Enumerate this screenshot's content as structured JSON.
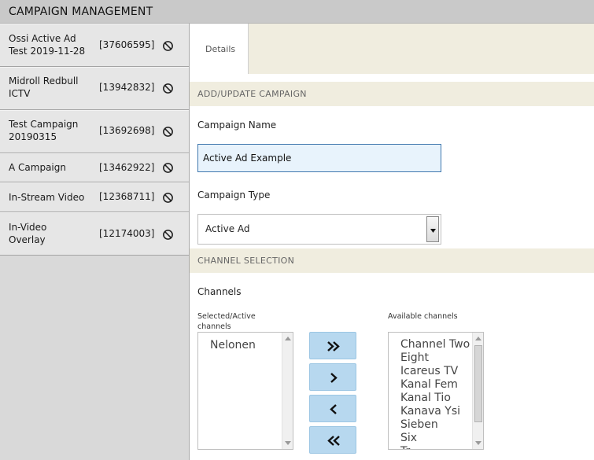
{
  "header": {
    "title": "CAMPAIGN MANAGEMENT"
  },
  "campaigns": [
    {
      "name": "Ossi Active Ad Test 2019-11-28",
      "id": "[37606595]"
    },
    {
      "name": "Midroll Redbull ICTV",
      "id": "[13942832]"
    },
    {
      "name": "Test Campaign 20190315",
      "id": "[13692698]"
    },
    {
      "name": "A Campaign",
      "id": "[13462922]"
    },
    {
      "name": "In-Stream Video",
      "id": "[12368711]"
    },
    {
      "name": "In-Video Overlay",
      "id": "[12174003]"
    }
  ],
  "tabs": [
    {
      "label": "Details"
    }
  ],
  "form": {
    "section_title": "ADD/UPDATE CAMPAIGN",
    "name_label": "Campaign Name",
    "name_value": "Active Ad Example",
    "type_label": "Campaign Type",
    "type_value": "Active Ad"
  },
  "channels": {
    "section_title": "CHANNEL SELECTION",
    "label": "Channels",
    "selected_label": "Selected/Active channels",
    "available_label": "Available channels",
    "selected": [
      "Nelonen"
    ],
    "available": [
      "Channel Two",
      "Eight",
      "Icareus TV",
      "Kanal Fem",
      "Kanal Tio",
      "Kanava Ysi",
      "Sieben",
      "Six",
      "Tr"
    ]
  },
  "icons": {
    "ban": "ban-icon",
    "add_all": "double-chevron-right-icon",
    "add_one": "chevron-right-icon",
    "remove_one": "chevron-left-icon",
    "remove_all": "double-chevron-left-icon"
  },
  "colors": {
    "header_bg": "#c9c9c9",
    "section_bg": "#f0eddf",
    "input_focus_bg": "#e8f3fc",
    "input_focus_border": "#3f77ae",
    "button_bg": "#b7d8ef"
  }
}
